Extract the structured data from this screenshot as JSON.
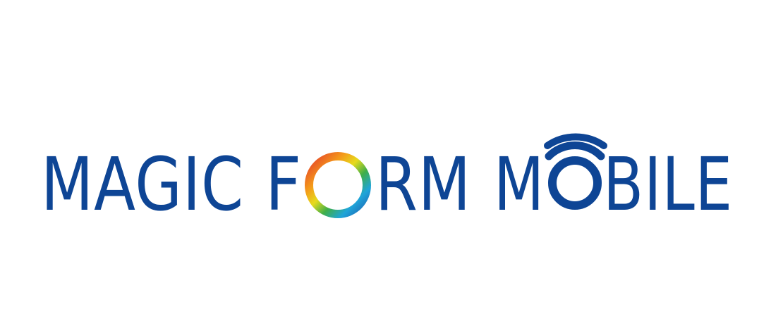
{
  "brand": {
    "name": "MAGIC FORM MOBILE",
    "word1": "MAGIC",
    "word2_start": "F",
    "word2_end": "RM",
    "word3_start": "M",
    "word3_end": "BILE"
  },
  "colors": {
    "primary_blue": "#0E4595",
    "ring_red": "#E4392B",
    "ring_orange": "#F49A1A",
    "ring_yellow": "#E6DB1C",
    "ring_green": "#3FAE49",
    "ring_cyan": "#1FA5D9",
    "ring_blue": "#1D5FB0",
    "background": "#FFFFFF"
  },
  "icons": {
    "ring": "rainbow-ring-icon",
    "signal": "wifi-signal-icon"
  }
}
